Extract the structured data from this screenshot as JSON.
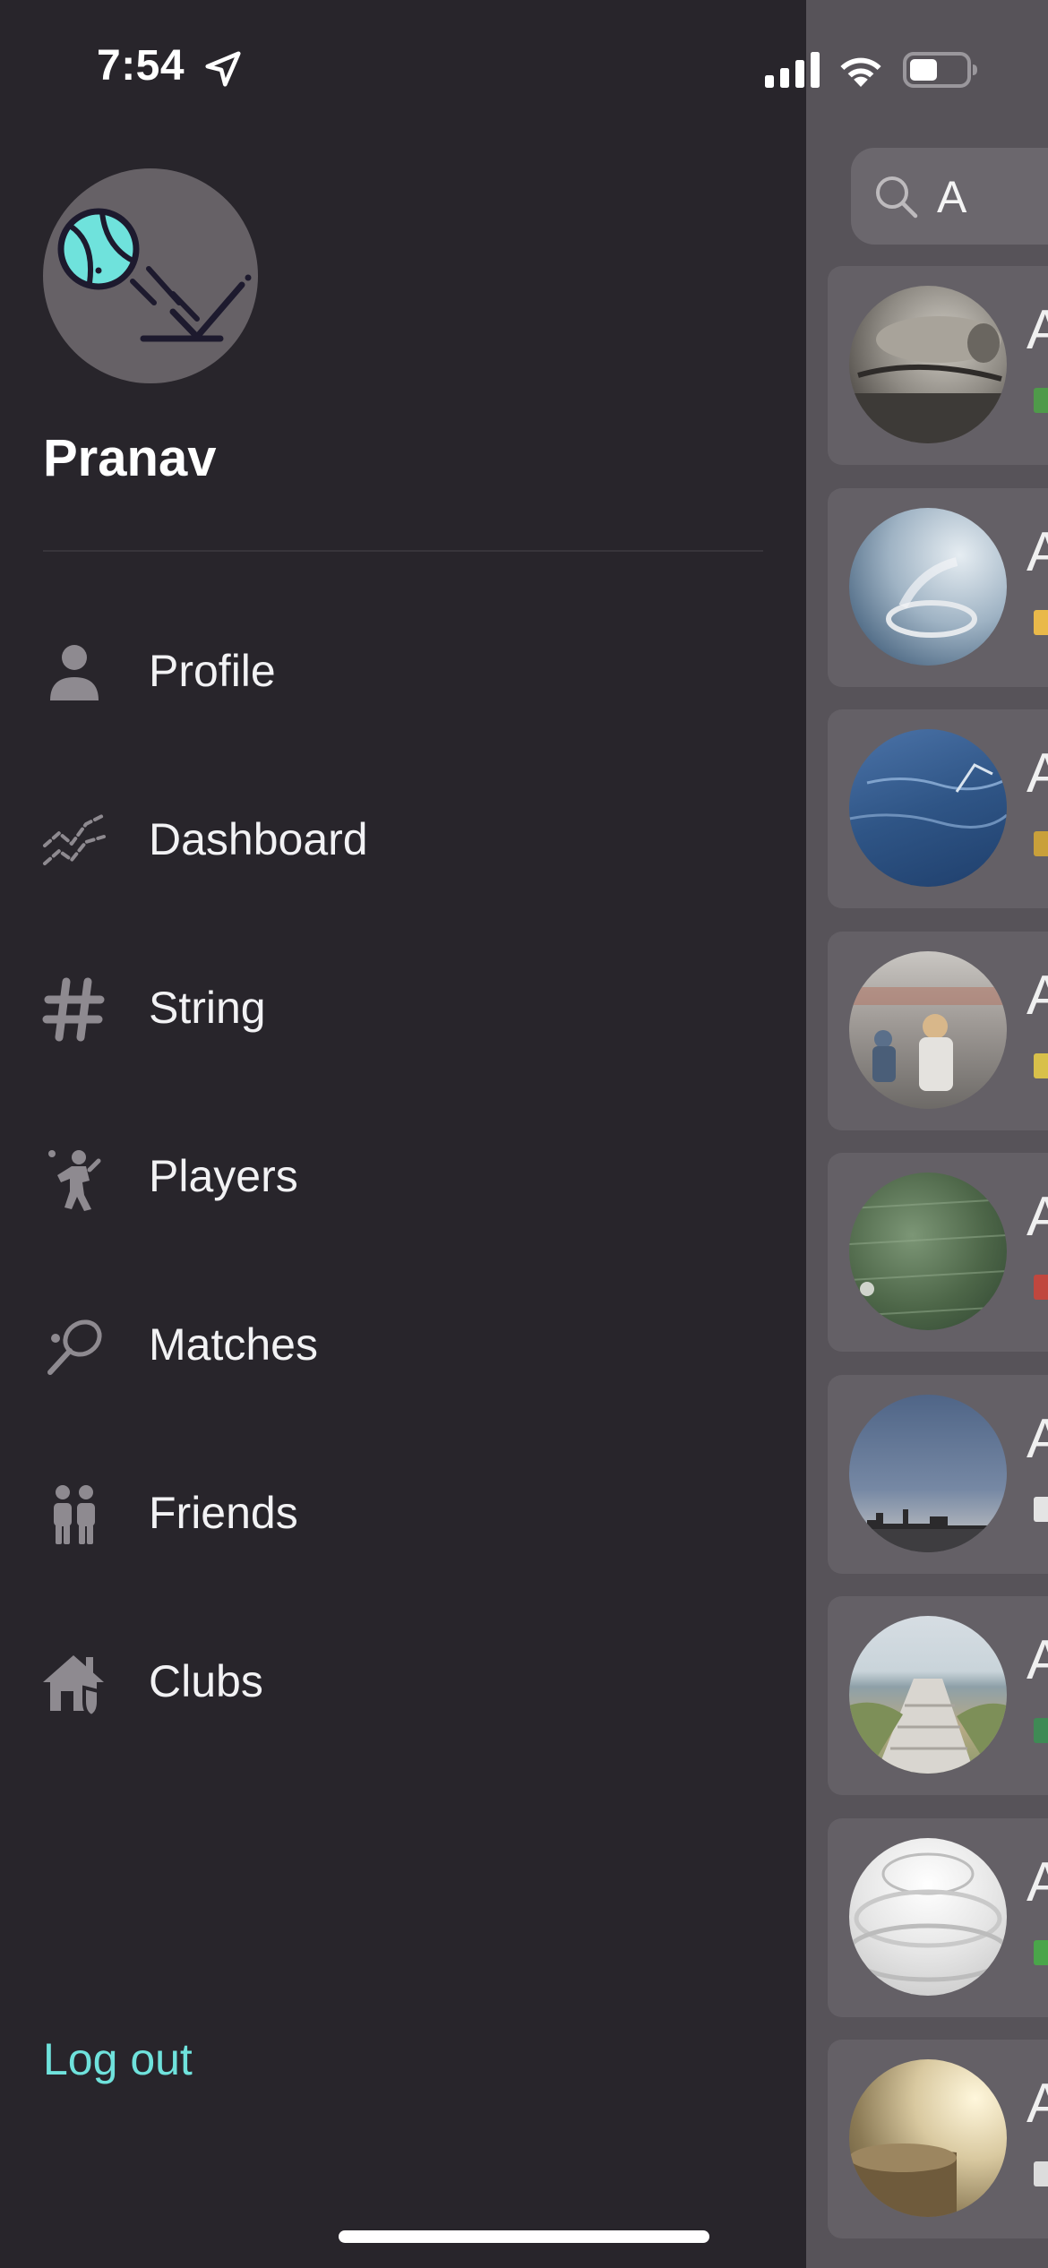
{
  "status_bar": {
    "time": "7:54",
    "icons": [
      "location-arrow-icon",
      "cellular-signal-icon",
      "wifi-icon",
      "battery-icon"
    ]
  },
  "drawer": {
    "user_name": "Pranav",
    "avatar_icon": "tennis-ball-bounce-icon",
    "menu": [
      {
        "label": "Profile",
        "icon": "person-icon"
      },
      {
        "label": "Dashboard",
        "icon": "chart-lines-icon"
      },
      {
        "label": "String",
        "icon": "hashtag-icon"
      },
      {
        "label": "Players",
        "icon": "tennis-player-icon"
      },
      {
        "label": "Matches",
        "icon": "tennis-racket-icon"
      },
      {
        "label": "Friends",
        "icon": "people-icon"
      },
      {
        "label": "Clubs",
        "icon": "house-shield-icon"
      }
    ],
    "logout_label": "Log out"
  },
  "main": {
    "search": {
      "value": "A",
      "icon": "search-icon"
    },
    "cards": [
      {
        "title": "A",
        "flag_color": "#4f9a4a"
      },
      {
        "title": "A",
        "flag_color": "#e9b94a"
      },
      {
        "title": "A",
        "flag_color": "#c9a03a"
      },
      {
        "title": "A",
        "flag_color": "#d8c04a"
      },
      {
        "title": "A",
        "flag_color": "#c0473e"
      },
      {
        "title": "A",
        "flag_color": "#e4e4e4"
      },
      {
        "title": "A",
        "flag_color": "#3f8a55"
      },
      {
        "title": "A",
        "flag_color": "#4aa54a"
      },
      {
        "title": "A",
        "flag_color": "#dcdcdc"
      }
    ]
  },
  "colors": {
    "drawer_bg": "#28252b",
    "accent": "#6fe2dc",
    "icon_gray": "#8e8a90",
    "overlay_bg": "#575359"
  }
}
